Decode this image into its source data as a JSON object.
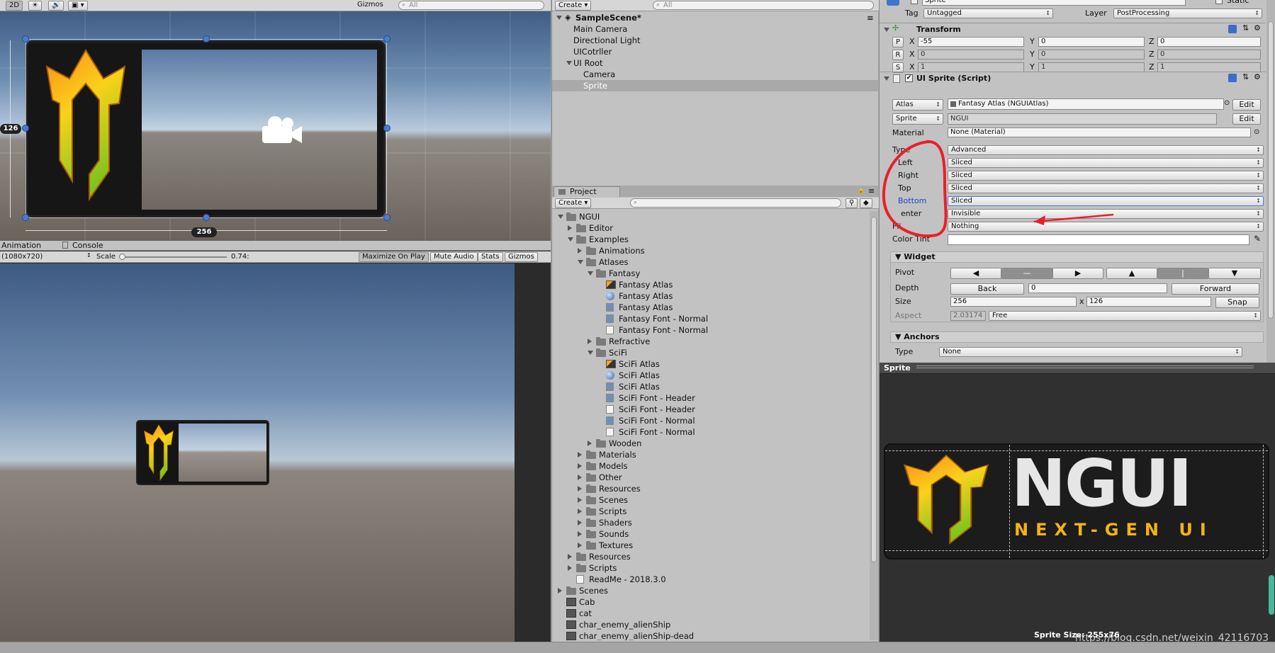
{
  "scene_view": {
    "toolbar": {
      "mode_2d": "2D",
      "gizmos": "Gizmos",
      "search_placeholder": "All"
    },
    "rect_width_label": "256",
    "rect_height_label": "126"
  },
  "game_view": {
    "tabs": [
      "Animation",
      "Console"
    ],
    "resolution": "(1080x720)",
    "scale_label": "Scale",
    "scale_value": "0.74:",
    "buttons": [
      "Maximize On Play",
      "Mute Audio",
      "Stats",
      "Gizmos"
    ]
  },
  "hierarchy": {
    "create": "Create",
    "search_placeholder": "All",
    "scene_name": "SampleScene*",
    "items": [
      "Main Camera",
      "Directional Light",
      "UICotrller",
      "UI Root",
      "Camera",
      "Sprite"
    ]
  },
  "project": {
    "tab": "Project",
    "create": "Create",
    "tree": [
      {
        "label": "NGUI",
        "depth": 0,
        "expander": "down",
        "icon": "folder"
      },
      {
        "label": "Editor",
        "depth": 1,
        "expander": "right",
        "icon": "folder"
      },
      {
        "label": "Examples",
        "depth": 1,
        "expander": "down",
        "icon": "folder"
      },
      {
        "label": "Animations",
        "depth": 2,
        "expander": "right",
        "icon": "folder"
      },
      {
        "label": "Atlases",
        "depth": 2,
        "expander": "down",
        "icon": "folder"
      },
      {
        "label": "Fantasy",
        "depth": 3,
        "expander": "down",
        "icon": "folder"
      },
      {
        "label": "Fantasy Atlas",
        "depth": 4,
        "expander": "",
        "icon": "texture"
      },
      {
        "label": "Fantasy Atlas",
        "depth": 4,
        "expander": "",
        "icon": "material"
      },
      {
        "label": "Fantasy Atlas",
        "depth": 4,
        "expander": "",
        "icon": "prefab"
      },
      {
        "label": "Fantasy Font - Normal",
        "depth": 4,
        "expander": "",
        "icon": "prefab"
      },
      {
        "label": "Fantasy Font - Normal",
        "depth": 4,
        "expander": "",
        "icon": "file"
      },
      {
        "label": "Refractive",
        "depth": 3,
        "expander": "right",
        "icon": "folder"
      },
      {
        "label": "SciFi",
        "depth": 3,
        "expander": "down",
        "icon": "folder"
      },
      {
        "label": "SciFi Atlas",
        "depth": 4,
        "expander": "",
        "icon": "texture"
      },
      {
        "label": "SciFi Atlas",
        "depth": 4,
        "expander": "",
        "icon": "material"
      },
      {
        "label": "SciFi Atlas",
        "depth": 4,
        "expander": "",
        "icon": "prefab"
      },
      {
        "label": "SciFi Font - Header",
        "depth": 4,
        "expander": "",
        "icon": "prefab"
      },
      {
        "label": "SciFi Font - Header",
        "depth": 4,
        "expander": "",
        "icon": "file"
      },
      {
        "label": "SciFi Font - Normal",
        "depth": 4,
        "expander": "",
        "icon": "prefab"
      },
      {
        "label": "SciFi Font - Normal",
        "depth": 4,
        "expander": "",
        "icon": "file"
      },
      {
        "label": "Wooden",
        "depth": 3,
        "expander": "right",
        "icon": "folder"
      },
      {
        "label": "Materials",
        "depth": 2,
        "expander": "right",
        "icon": "folder"
      },
      {
        "label": "Models",
        "depth": 2,
        "expander": "right",
        "icon": "folder"
      },
      {
        "label": "Other",
        "depth": 2,
        "expander": "right",
        "icon": "folder"
      },
      {
        "label": "Resources",
        "depth": 2,
        "expander": "right",
        "icon": "folder"
      },
      {
        "label": "Scenes",
        "depth": 2,
        "expander": "right",
        "icon": "folder"
      },
      {
        "label": "Scripts",
        "depth": 2,
        "expander": "right",
        "icon": "folder"
      },
      {
        "label": "Shaders",
        "depth": 2,
        "expander": "right",
        "icon": "folder"
      },
      {
        "label": "Sounds",
        "depth": 2,
        "expander": "right",
        "icon": "folder"
      },
      {
        "label": "Textures",
        "depth": 2,
        "expander": "right",
        "icon": "folder"
      },
      {
        "label": "Resources",
        "depth": 1,
        "expander": "right",
        "icon": "folder"
      },
      {
        "label": "Scripts",
        "depth": 1,
        "expander": "right",
        "icon": "folder"
      },
      {
        "label": "ReadMe - 2018.3.0",
        "depth": 1,
        "expander": "",
        "icon": "file"
      },
      {
        "label": "Scenes",
        "depth": 0,
        "expander": "right",
        "icon": "folder"
      },
      {
        "label": "Cab",
        "depth": 0,
        "expander": "",
        "icon": "image"
      },
      {
        "label": "cat",
        "depth": 0,
        "expander": "",
        "icon": "image"
      },
      {
        "label": "char_enemy_alienShip",
        "depth": 0,
        "expander": "",
        "icon": "image"
      },
      {
        "label": "char_enemy_alienShip-dead",
        "depth": 0,
        "expander": "",
        "icon": "image"
      }
    ]
  },
  "inspector": {
    "object_name": "Sprite",
    "static_label": "Static",
    "tag_label": "Tag",
    "tag_value": "Untagged",
    "layer_label": "Layer",
    "layer_value": "PostProcessing",
    "transform": {
      "title": "Transform",
      "rows": [
        {
          "btn": "P",
          "x": "-55",
          "y": "0",
          "z": "0"
        },
        {
          "btn": "R",
          "x": "0",
          "y": "0",
          "z": "0"
        },
        {
          "btn": "S",
          "x": "1",
          "y": "1",
          "z": "1"
        }
      ],
      "axis_x": "X",
      "axis_y": "Y",
      "axis_z": "Z"
    },
    "ui_sprite": {
      "title": "UI Sprite (Script)",
      "atlas_btn": "Atlas",
      "atlas_value": "Fantasy Atlas (NGUIAtlas)",
      "sprite_btn": "Sprite",
      "sprite_value": "NGUI",
      "edit": "Edit",
      "material_label": "Material",
      "material_value": "None (Material)",
      "type_label": "Type",
      "type_value": "Advanced",
      "left_label": "Left",
      "left_value": "Sliced",
      "right_label": "Right",
      "right_value": "Sliced",
      "top_label": "Top",
      "top_value": "Sliced",
      "bottom_label": "Bottom",
      "bottom_value": "Sliced",
      "center_label": "enter",
      "center_value": "Invisible",
      "flip_label": "Fli",
      "flip_value": "Nothing",
      "color_tint_label": "Color Tint"
    },
    "widget": {
      "title": "Widget",
      "pivot_label": "Pivot",
      "depth_label": "Depth",
      "back": "Back",
      "depth_value": "0",
      "forward": "Forward",
      "size_label": "Size",
      "width": "256",
      "times": "x",
      "height": "126",
      "snap": "Snap",
      "aspect_label": "Aspect",
      "aspect_value": "2.03174",
      "aspect_mode": "Free"
    },
    "anchors": {
      "title": "Anchors",
      "type_label": "Type",
      "type_value": "None"
    }
  },
  "preview": {
    "title": "Sprite",
    "logo_text": "NGUI",
    "logo_sub": "NEXT-GEN UI",
    "size_label": "Sprite Size: 255x76"
  },
  "watermark": "https://blog.csdn.net/weixin_42116703",
  "colors": {
    "selection": "#a9a9a9",
    "blue_label": "#1a45d6",
    "annotation_red": "#e8202a",
    "handle_blue": "#4a7bd0"
  }
}
